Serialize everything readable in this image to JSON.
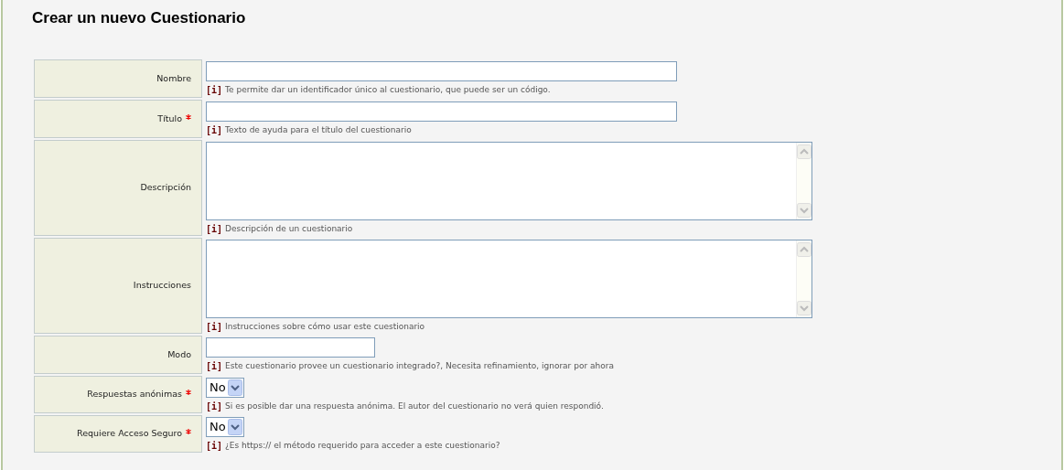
{
  "title": "Crear un nuevo Cuestionario",
  "fields": [
    {
      "kind": "text",
      "label": "Nombre",
      "required": false,
      "info_mark": "[i]",
      "hint": "Te permite dar un identificador único al cuestionario, que puede ser un código."
    },
    {
      "kind": "text",
      "label": "Título",
      "required": true,
      "info_mark": "[i]",
      "hint": "Texto de ayuda para el título del cuestionario"
    },
    {
      "kind": "textarea",
      "label": "Descripción",
      "required": false,
      "info_mark": "[i]",
      "hint": "Descripción de un cuestionario"
    },
    {
      "kind": "textarea",
      "label": "Instrucciones",
      "required": false,
      "info_mark": "[i]",
      "hint": "Instrucciones sobre cómo usar este cuestionario"
    },
    {
      "kind": "short",
      "label": "Modo",
      "required": false,
      "info_mark": "[i]",
      "hint": "Este cuestionario provee un cuestionario integrado?, Necesita refinamiento, ignorar por ahora"
    },
    {
      "kind": "select",
      "label": "Respuestas anónimas",
      "required": true,
      "value": "No",
      "info_mark": "[i]",
      "hint": "Si es posible dar una respuesta anónima. El autor del cuestionario no verá quien respondió."
    },
    {
      "kind": "select",
      "label": "Requiere Acceso Seguro",
      "required": true,
      "value": "No",
      "info_mark": "[i]",
      "hint": "¿Es https:// el método requerido para acceder a este cuestionario?"
    }
  ]
}
